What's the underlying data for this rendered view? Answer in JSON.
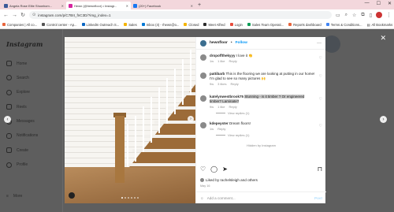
{
  "browser": {
    "tabs": [
      {
        "title": "Angela Rose Elite Showhom...",
        "color": "#3c5a99"
      },
      {
        "title": "Hewn (@hewnfloor) • Instagr...",
        "color": "#d6249f",
        "active": true
      },
      {
        "title": "(20+) Facebook",
        "color": "#1877f2"
      }
    ],
    "url": "instagram.com/p/C7BII_fnC3D/?img_index=1",
    "bookmarks": [
      "Companies | All co...",
      "Control center - Ap...",
      "LinkedIn Outreach S...",
      "Sales",
      "Inbox (4) - rhewn@o...",
      "Closed",
      "Meet Alfred",
      "Login",
      "Sales Team Operati...",
      "Reports dashboard",
      "Terms & Conditions..."
    ],
    "all_bookmarks": "All Bookmarks"
  },
  "instagram": {
    "logo": "Instagram",
    "nav": [
      "Home",
      "Search",
      "Explore",
      "Reels",
      "Messages",
      "Notifications",
      "Create",
      "Profile"
    ],
    "more": "More"
  },
  "post": {
    "username": "hewnfloor",
    "follow": "Follow",
    "comments": [
      {
        "user": "dropoffthekyyy",
        "text": "I love it 👏",
        "time": "1w",
        "likes": "1 like",
        "reply": "Reply"
      },
      {
        "user": "pattibarb",
        "text": "This is the flooring we are looking at putting in our home! I'm glad to see so many pictures 🙌",
        "time": "9w",
        "likes": "3 likes",
        "reply": "Reply"
      },
      {
        "user": "katelynwestbrook75",
        "text": "Stunning - is it timber ? Or engineered timber? Laminate?",
        "time": "9w",
        "likes": "1 like",
        "reply": "Reply",
        "replies": "View replies (1)",
        "highlight": true
      },
      {
        "user": "kdepeyster",
        "text": "Dream floors!",
        "time": "1w",
        "likes": "",
        "reply": "Reply",
        "replies": "View replies (1)"
      }
    ],
    "hidden_by": "Hidden by Instagram",
    "liked_by": "Liked by rachelsleigh and others",
    "date": "May 16",
    "add_comment_placeholder": "Add a comment...",
    "post_label": "Post"
  }
}
